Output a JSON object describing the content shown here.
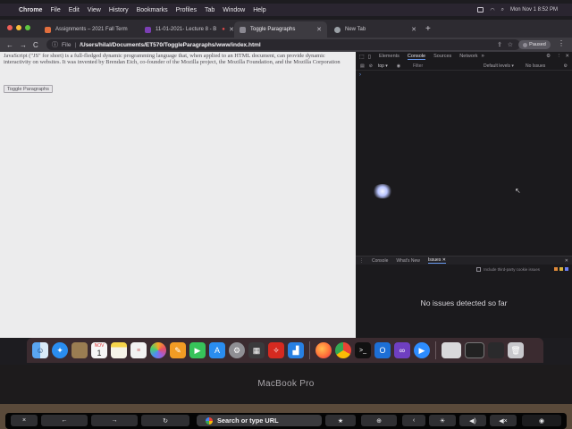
{
  "menubar": {
    "items": [
      "Chrome",
      "File",
      "Edit",
      "View",
      "History",
      "Bookmarks",
      "Profiles",
      "Tab",
      "Window",
      "Help"
    ],
    "clock": "Mon Nov 1  8:52 PM"
  },
  "tabs": [
    {
      "label": "Assignments – 2021 Fall Term",
      "favicon_color": "#e26f3e"
    },
    {
      "label": "11-01-2021- Lecture 8 - B",
      "favicon_color": "#7b3fb4"
    },
    {
      "label": "Toggle Paragraphs",
      "favicon_color": "#8a8891"
    },
    {
      "label": "New Tab",
      "favicon_color": "#9aa0a6"
    }
  ],
  "address": {
    "scheme": "File",
    "url": "/Users/hilal/Documents/ET570/ToggleParagraphs/www/index.html",
    "profile": "Paused"
  },
  "page": {
    "paragraph": "JavaScript (\"JS\" for short) is a full-fledged dynamic programming language that, when applied to an HTML document, can provide dynamic interactivity on websites. It was invented by Brendan Eich, co-founder of the Mozilla project, the Mozilla Foundation, and the Mozilla Corporation",
    "button": "Toggle Paragraphs"
  },
  "devtools": {
    "tabs": [
      "Elements",
      "Console",
      "Sources",
      "Network"
    ],
    "active_tab": "Console",
    "context": "top",
    "filter_placeholder": "Filter",
    "levels": "Default levels",
    "no_issues_short": "No Issues",
    "drawer_tabs": [
      "Console",
      "What's New",
      "Issues"
    ],
    "active_drawer_tab": "Issues",
    "third_party": "Include third-party cookie issues",
    "no_issues": "No issues detected so far"
  },
  "dock": {
    "calendar_month": "NOV",
    "calendar_day": "1"
  },
  "brand": "MacBook Pro",
  "touchbar": {
    "search": "Search or type URL"
  }
}
